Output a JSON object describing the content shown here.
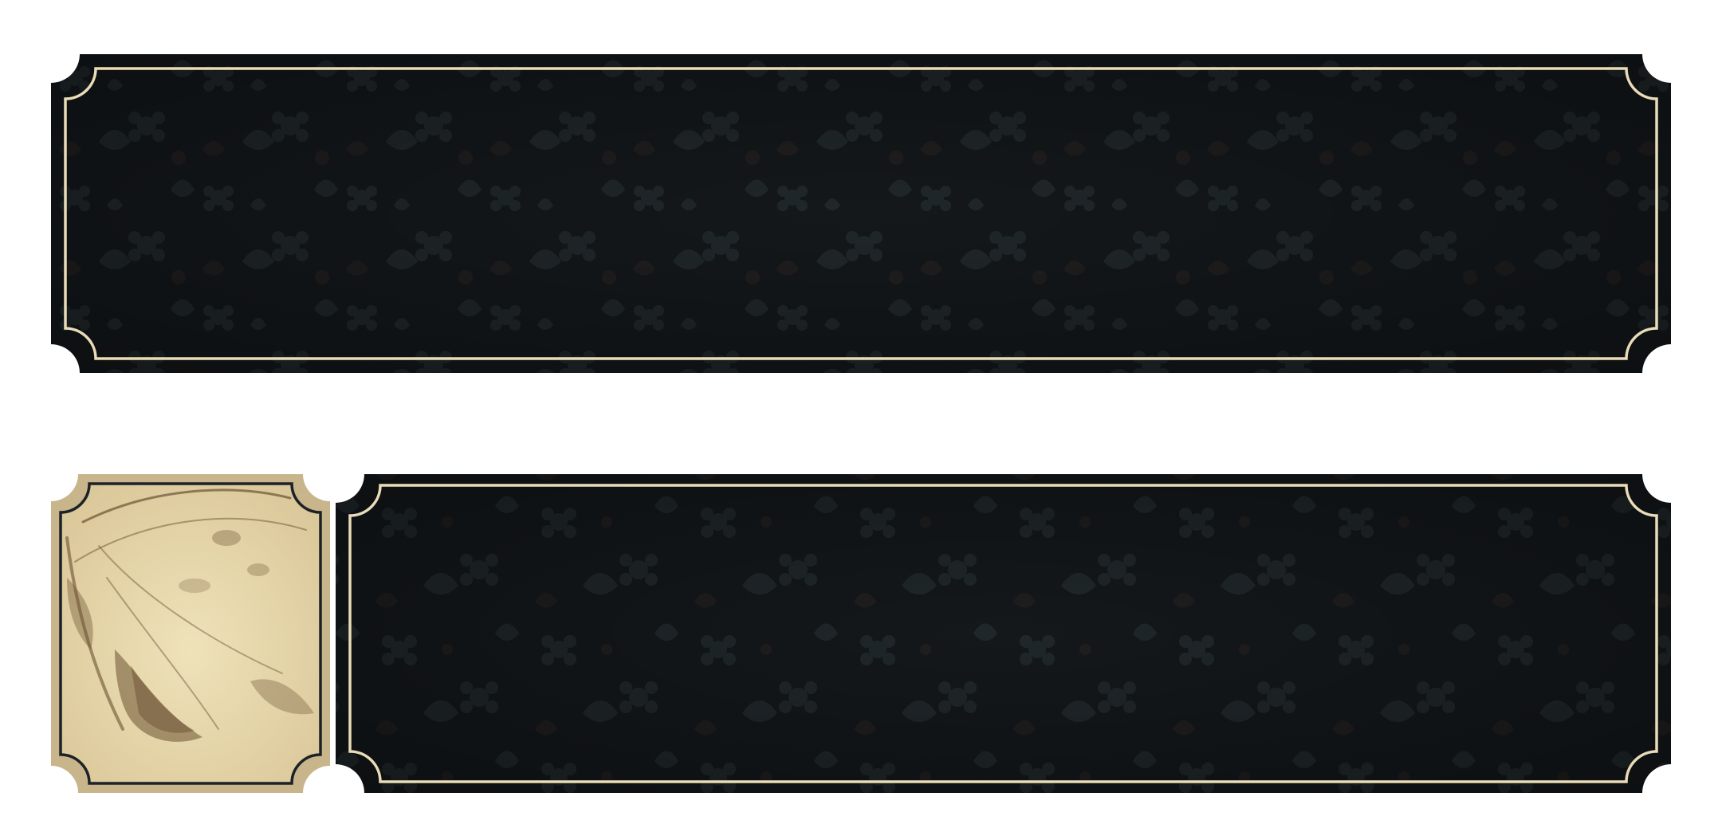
{
  "theme": {
    "panel_fill": "#14181b",
    "panel_edge": "#0f1315",
    "pattern_tint": "#2a3236",
    "pattern_tint_warm": "#2e2520",
    "border_cream": "#e9dcb8",
    "thumb_paper": "#e6d6a8",
    "thumb_frame": "#c9b58c",
    "thumb_ink": "#6b5233",
    "thumb_inner_border": "#1c2226"
  },
  "panels": [
    {
      "id": "panel-top",
      "role": "empty-dark-banner"
    },
    {
      "id": "panel-bottom-thumb",
      "role": "moth-illustration-thumbnail",
      "icon": "moth-wing-icon"
    },
    {
      "id": "panel-bottom-main",
      "role": "empty-dark-banner"
    }
  ]
}
